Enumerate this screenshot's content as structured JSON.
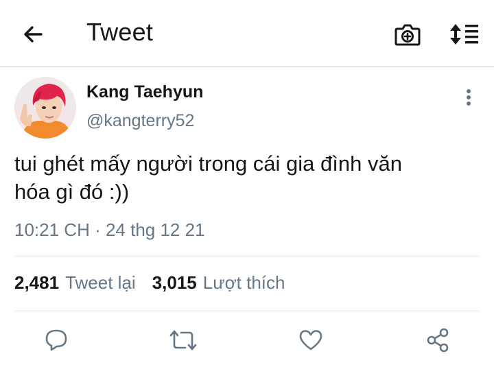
{
  "header": {
    "title": "Tweet",
    "back_icon": "arrow-left-icon",
    "camera_icon": "camera-plus-icon",
    "sort_icon": "sort-lines-icon"
  },
  "tweet": {
    "author_name": "Kang Taehyun",
    "author_handle": "@kangterry52",
    "text_line1": "tui ghét mấy người trong cái gia đình văn",
    "text_line2": "hóa gì đó :))",
    "timestamp": "10:21 CH · 24 thg 12 21"
  },
  "stats": {
    "retweet_count": "2,481",
    "retweet_label": "Tweet lại",
    "like_count": "3,015",
    "like_label": "Lượt thích"
  },
  "actions": [
    "reply-icon",
    "retweet-icon",
    "heart-icon",
    "share-icon"
  ],
  "colors": {
    "text_primary": "#14171a",
    "text_secondary": "#657786",
    "divider": "#e1e8ed",
    "avatar_hair": "#e0244a",
    "avatar_shirt": "#f28a2e"
  }
}
